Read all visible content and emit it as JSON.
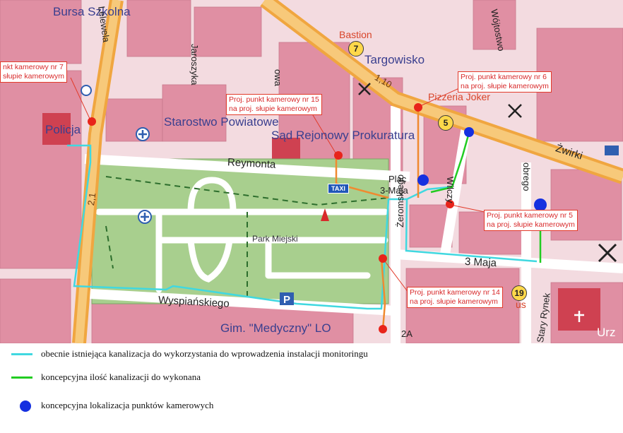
{
  "map": {
    "places": {
      "bursa": "Bursa Szkolna",
      "policja": "Policja",
      "starostwo": "Starostwo Powiatowe",
      "sad": "Sąd Rejonowy Prokuratura",
      "targowisko": "Targowisko",
      "bastion": "Bastion",
      "pizzeria": "Pizzeria Joker",
      "park": "Park Miejski",
      "gim": "Gim. \"Medyczny\" LO",
      "urz": "Urz"
    },
    "streets": {
      "lelewela": "Lelewela",
      "jaroszyka": "Jaroszyka",
      "kowa": "owa",
      "reymonta": "Reymonta",
      "plac": "Plac",
      "plac_3maja": "3-Maja",
      "wojtostwo": "Wójtostwo",
      "zwirki": "Żwirki",
      "dobrego": "obrego",
      "zeromskiego": "Żeromskiego",
      "trzeciego_maja": "3 Maja",
      "wyspianskiego": "Wyspiańskiego",
      "stary_rynek": "Stary Rynek",
      "wilczy": "Wilczy",
      "num_2a": "2A",
      "km_21": "2,1",
      "km_110": "1,10",
      "us": "us"
    },
    "badges": {
      "b7": "7",
      "b5": "5",
      "b19": "19"
    },
    "taxi": "TAXI",
    "callouts": {
      "c7_line1": "nkt kamerowy nr 7",
      "c7_line2": "słupie kamerowym",
      "c15_line1": "Proj. punkt kamerowy nr 15",
      "c15_line2": "na proj. słupie kamerowym",
      "c6_line1": "Proj. punkt kamerowy nr 6",
      "c6_line2": "na proj. słupie kamerowym",
      "c5_line1": "Proj. punkt kamerowy nr 5",
      "c5_line2": "na proj. słupie kamerowym",
      "c14_line1": "Proj. punkt kamerowy nr 14",
      "c14_line2": "na proj. słupie kamerowym"
    },
    "colors": {
      "existing_channel": "#40d8e0",
      "planned_channel": "#22cc22",
      "camera_point": "#1530e0",
      "projected_point": "#e8241a",
      "park": "#a8cf8e",
      "building": "#e08fa3",
      "main_road": "#f0a640"
    }
  },
  "legend": {
    "items": [
      {
        "label": "obecnie istniejąca kanalizacja do wykorzystania do wprowadzenia instalacji monitoringu",
        "color": "#40d8e0",
        "kind": "line"
      },
      {
        "label": "koncepcyjna ilość kanalizacji do wykonana",
        "color": "#22cc22",
        "kind": "line"
      },
      {
        "label": "koncepcyjna lokalizacja punktów kamerowych",
        "color": "#1530e0",
        "kind": "dot"
      }
    ]
  }
}
